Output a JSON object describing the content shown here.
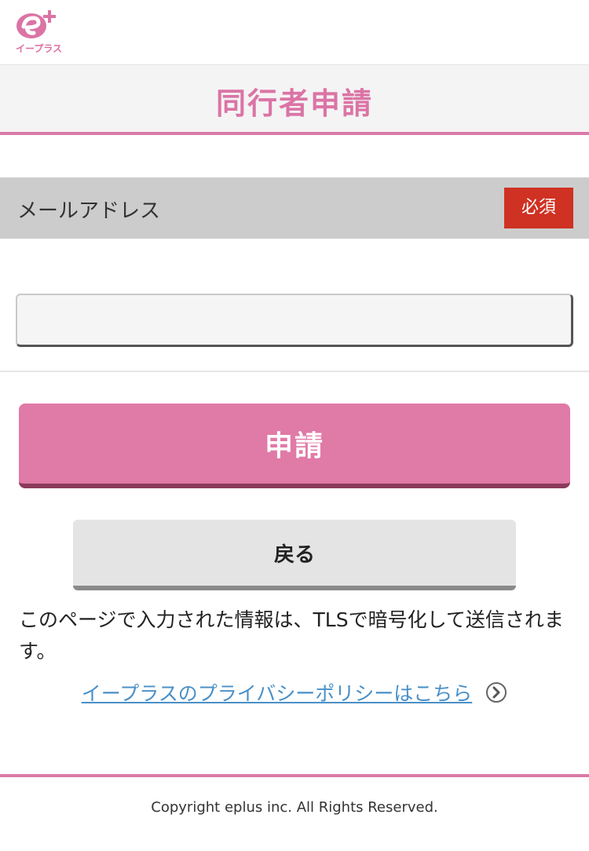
{
  "header": {
    "logo_text": "イープラス",
    "logo_icon": "eplus-logo-icon",
    "brand_color": "#db74a5"
  },
  "title": {
    "text": "同行者申請"
  },
  "form": {
    "email_label": "メールアドレス",
    "required_label": "必須",
    "email_value": "",
    "email_placeholder": ""
  },
  "buttons": {
    "submit_label": "申請",
    "back_label": "戻る"
  },
  "notice": {
    "text": "このページで入力された情報は、TLSで暗号化して送信されます。"
  },
  "privacy": {
    "link_text": "イープラスのプライバシーポリシーはこちら",
    "icon": "chevron-right-circle-icon"
  },
  "footer": {
    "copyright": "Copyright eplus inc. All Rights Reserved."
  },
  "colors": {
    "pink": "#e07aa7",
    "required_red": "#cf3122",
    "link_blue": "#4a90c7",
    "label_band": "#cccccc"
  }
}
